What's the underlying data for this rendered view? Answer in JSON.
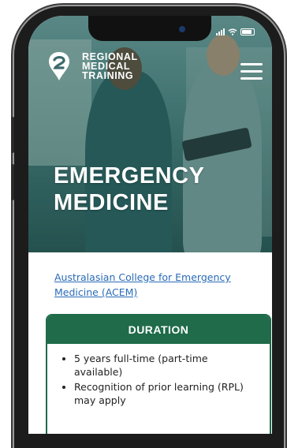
{
  "status_bar": {
    "icons": [
      "signal-icon",
      "wifi-icon",
      "battery-icon"
    ]
  },
  "header": {
    "logo_lines": [
      "REGIONAL",
      "MEDICAL",
      "TRAINING"
    ],
    "menu_icon": "hamburger-menu-icon"
  },
  "hero": {
    "title_lines": [
      "EMERGENCY",
      "MEDICINE"
    ]
  },
  "body": {
    "college_link": "Australasian College for Emergency Medicine (ACEM)"
  },
  "duration": {
    "heading": "DURATION",
    "items": [
      "5 years full-time (part-time available)",
      "Recognition of prior learning (RPL) may apply"
    ]
  },
  "colors": {
    "brand_green": "#1f6b4a",
    "link_blue": "#2a6bb8",
    "hero_text": "#ffffff"
  }
}
